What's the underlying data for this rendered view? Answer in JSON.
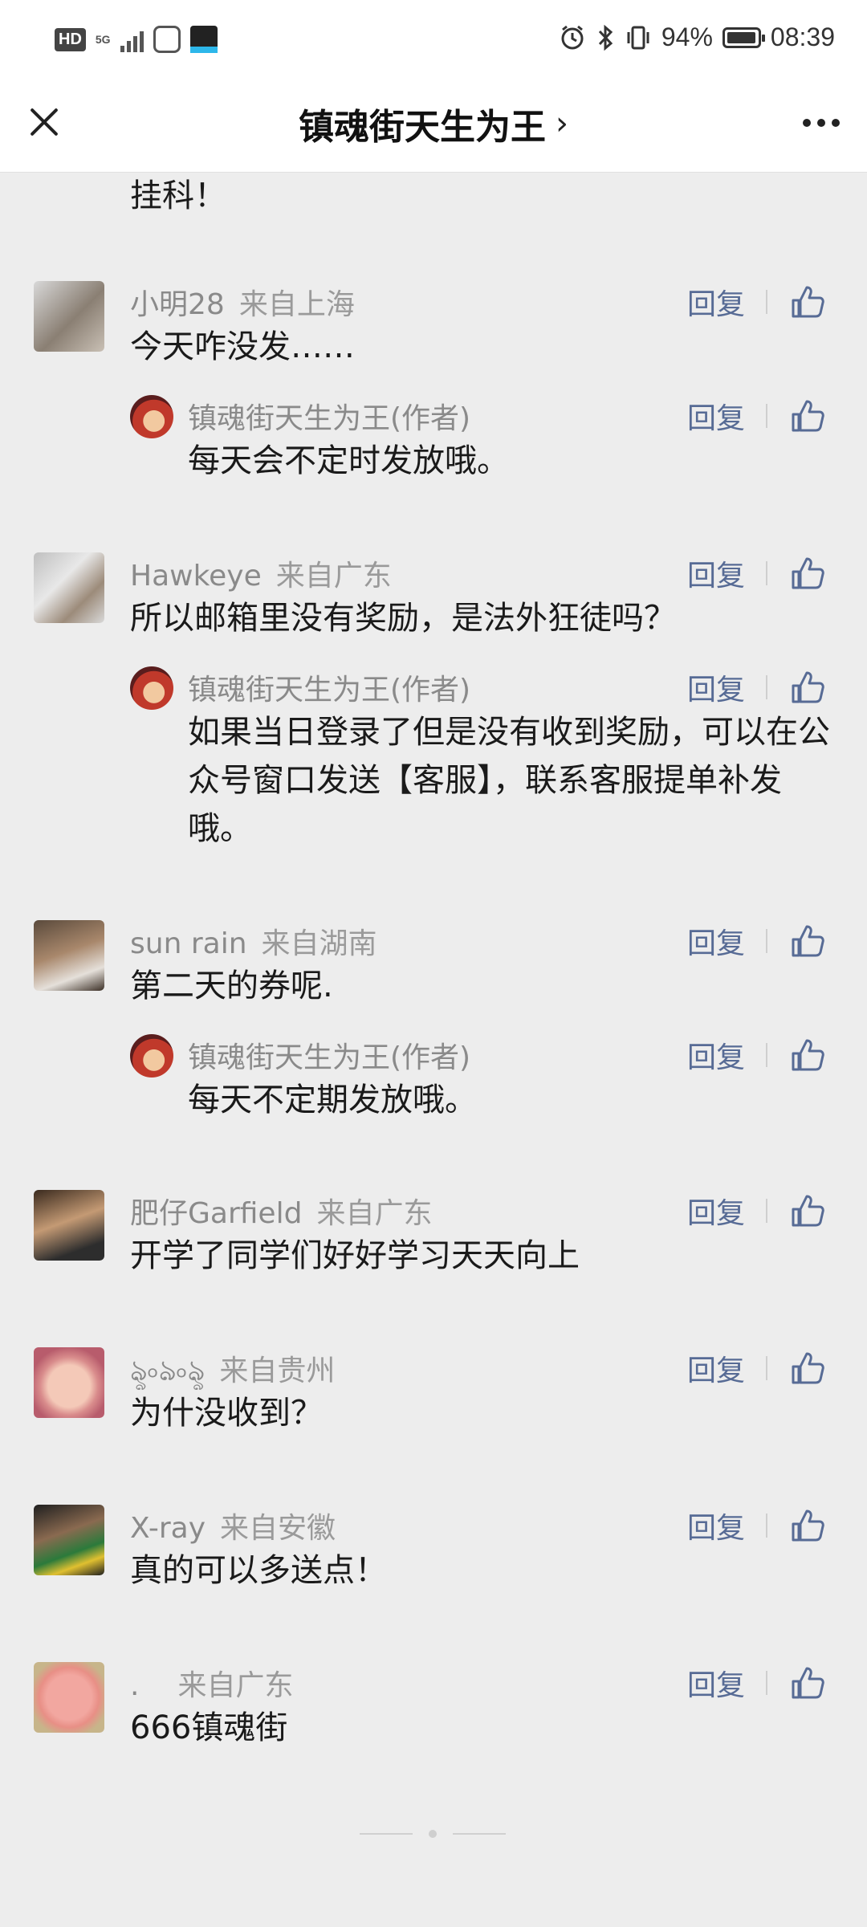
{
  "statusbar": {
    "hd": "HD",
    "network": "5G",
    "battery_pct": "94%",
    "time": "08:39"
  },
  "titlebar": {
    "title": "镇魂街天生为王",
    "chevron": "›"
  },
  "actions": {
    "reply": "回复"
  },
  "comments": [
    {
      "name": "",
      "loc": "",
      "text": "挂科！"
    },
    {
      "name": "小明28",
      "loc": "来自上海",
      "text": "今天咋没发……",
      "reply": {
        "name": "镇魂街天生为王(作者)",
        "text": "每天会不定时发放哦。"
      }
    },
    {
      "name": "Hawkeye",
      "loc": "来自广东",
      "text": "所以邮箱里没有奖励，是法外狂徒吗？",
      "reply": {
        "name": "镇魂街天生为王(作者)",
        "text": "如果当日登录了但是没有收到奖励，可以在公众号窗口发送【客服】，联系客服提单补发哦。"
      }
    },
    {
      "name": "sun rain",
      "loc": "来自湖南",
      "text": "第二天的券呢.",
      "reply": {
        "name": "镇魂街天生为王(作者)",
        "text": "每天不定期发放哦。"
      }
    },
    {
      "name": "肥仔Garfield",
      "loc": "来自广东",
      "text": "开学了同学们好好学习天天向上"
    },
    {
      "name": "ৡ৹ঌ৹ৡ",
      "loc": "来自贵州",
      "text": "为什没收到？"
    },
    {
      "name": "X-ray",
      "loc": "来自安徽",
      "text": "真的可以多送点！"
    },
    {
      "name": ".",
      "loc": "来自广东",
      "text": "666镇魂街"
    }
  ],
  "colors": {
    "background": "#ededed",
    "link": "#576b95",
    "meta": "#8a8a8a"
  }
}
